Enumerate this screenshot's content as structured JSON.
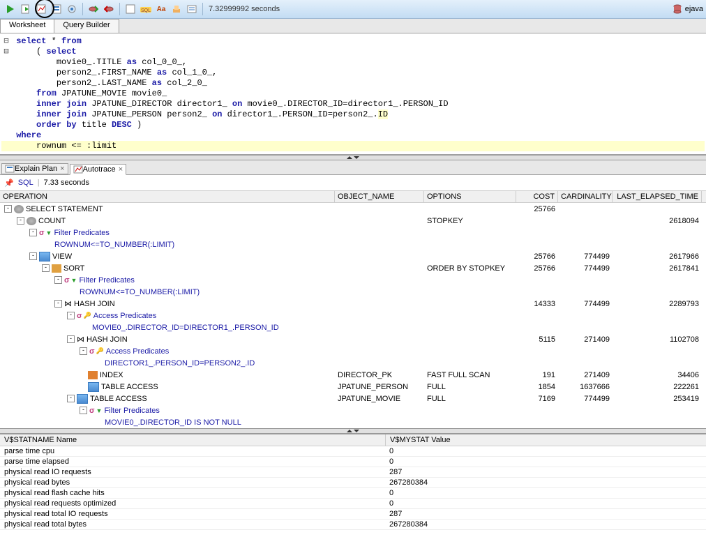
{
  "toolbar": {
    "timing": "7.32999992 seconds",
    "connection": "ejava"
  },
  "tabs": {
    "worksheet": "Worksheet",
    "querybuilder": "Query Builder"
  },
  "sql": {
    "l1": {
      "a": "select",
      "b": " * ",
      "c": "from"
    },
    "l2": {
      "a": "( ",
      "b": "select"
    },
    "l3": {
      "a": "movie0_.TITLE ",
      "b": "as",
      "c": " col_0_0_,"
    },
    "l4": {
      "a": "person2_.FIRST_NAME ",
      "b": "as",
      "c": " col_1_0_,"
    },
    "l5": {
      "a": "person2_.LAST_NAME ",
      "b": "as",
      "c": " col_2_0_"
    },
    "l6": {
      "a": "from",
      "b": " JPATUNE_MOVIE movie0_"
    },
    "l7": {
      "a": "inner join",
      "b": " JPATUNE_DIRECTOR director1_ ",
      "c": "on",
      "d": " movie0_.DIRECTOR_ID=director1_.PERSON_ID"
    },
    "l8": {
      "a": "inner join",
      "b": " JPATUNE_PERSON person2_ ",
      "c": "on",
      "d": " director1_.PERSON_ID=person2_.",
      "e": "ID"
    },
    "l9": {
      "a": "order by",
      "b": " title ",
      "c": "DESC",
      "d": " )"
    },
    "l10": {
      "a": "where"
    },
    "l11": {
      "a": "rownum <= :limit"
    }
  },
  "result_tabs": {
    "explain": "Explain Plan",
    "autotrace": "Autotrace"
  },
  "result_toolbar": {
    "sql": "SQL",
    "time": "7.33 seconds"
  },
  "plan_header": {
    "operation": "OPERATION",
    "object": "OBJECT_NAME",
    "options": "OPTIONS",
    "cost": "COST",
    "card": "CARDINALITY",
    "time": "LAST_ELAPSED_TIME"
  },
  "plan": {
    "r1": {
      "op": "SELECT STATEMENT",
      "cost": "25766"
    },
    "r2": {
      "op": "COUNT",
      "opt": "STOPKEY",
      "time": "2618094"
    },
    "r3": {
      "op": "Filter Predicates"
    },
    "r4": {
      "op": "ROWNUM<=TO_NUMBER(:LIMIT)"
    },
    "r5": {
      "op": "VIEW",
      "cost": "25766",
      "card": "774499",
      "time": "2617966"
    },
    "r6": {
      "op": "SORT",
      "opt": "ORDER BY STOPKEY",
      "cost": "25766",
      "card": "774499",
      "time": "2617841"
    },
    "r7": {
      "op": "Filter Predicates"
    },
    "r8": {
      "op": "ROWNUM<=TO_NUMBER(:LIMIT)"
    },
    "r9": {
      "op": "HASH JOIN",
      "cost": "14333",
      "card": "774499",
      "time": "2289793"
    },
    "r10": {
      "op": "Access Predicates"
    },
    "r11": {
      "op": "MOVIE0_.DIRECTOR_ID=DIRECTOR1_.PERSON_ID"
    },
    "r12": {
      "op": "HASH JOIN",
      "cost": "5115",
      "card": "271409",
      "time": "1102708"
    },
    "r13": {
      "op": "Access Predicates"
    },
    "r14": {
      "op": "DIRECTOR1_.PERSON_ID=PERSON2_.ID"
    },
    "r15": {
      "op": "INDEX",
      "obj": "DIRECTOR_PK",
      "opt": "FAST FULL SCAN",
      "cost": "191",
      "card": "271409",
      "time": "34406"
    },
    "r16": {
      "op": "TABLE ACCESS",
      "obj": "JPATUNE_PERSON",
      "opt": "FULL",
      "cost": "1854",
      "card": "1637666",
      "time": "222261"
    },
    "r17": {
      "op": "TABLE ACCESS",
      "obj": "JPATUNE_MOVIE",
      "opt": "FULL",
      "cost": "7169",
      "card": "774499",
      "time": "253419"
    },
    "r18": {
      "op": "Filter Predicates"
    },
    "r19": {
      "op": "MOVIE0_.DIRECTOR_ID IS NOT NULL"
    }
  },
  "stats_header": {
    "name": "V$STATNAME Name",
    "val": "V$MYSTAT Value"
  },
  "stats": {
    "s1": {
      "n": "parse time cpu",
      "v": "0"
    },
    "s2": {
      "n": "parse time elapsed",
      "v": "0"
    },
    "s3": {
      "n": "physical read IO requests",
      "v": "287"
    },
    "s4": {
      "n": "physical read bytes",
      "v": "267280384"
    },
    "s5": {
      "n": "physical read flash cache hits",
      "v": "0"
    },
    "s6": {
      "n": "physical read requests optimized",
      "v": "0"
    },
    "s7": {
      "n": "physical read total IO requests",
      "v": "287"
    },
    "s8": {
      "n": "physical read total bytes",
      "v": "267280384"
    }
  }
}
